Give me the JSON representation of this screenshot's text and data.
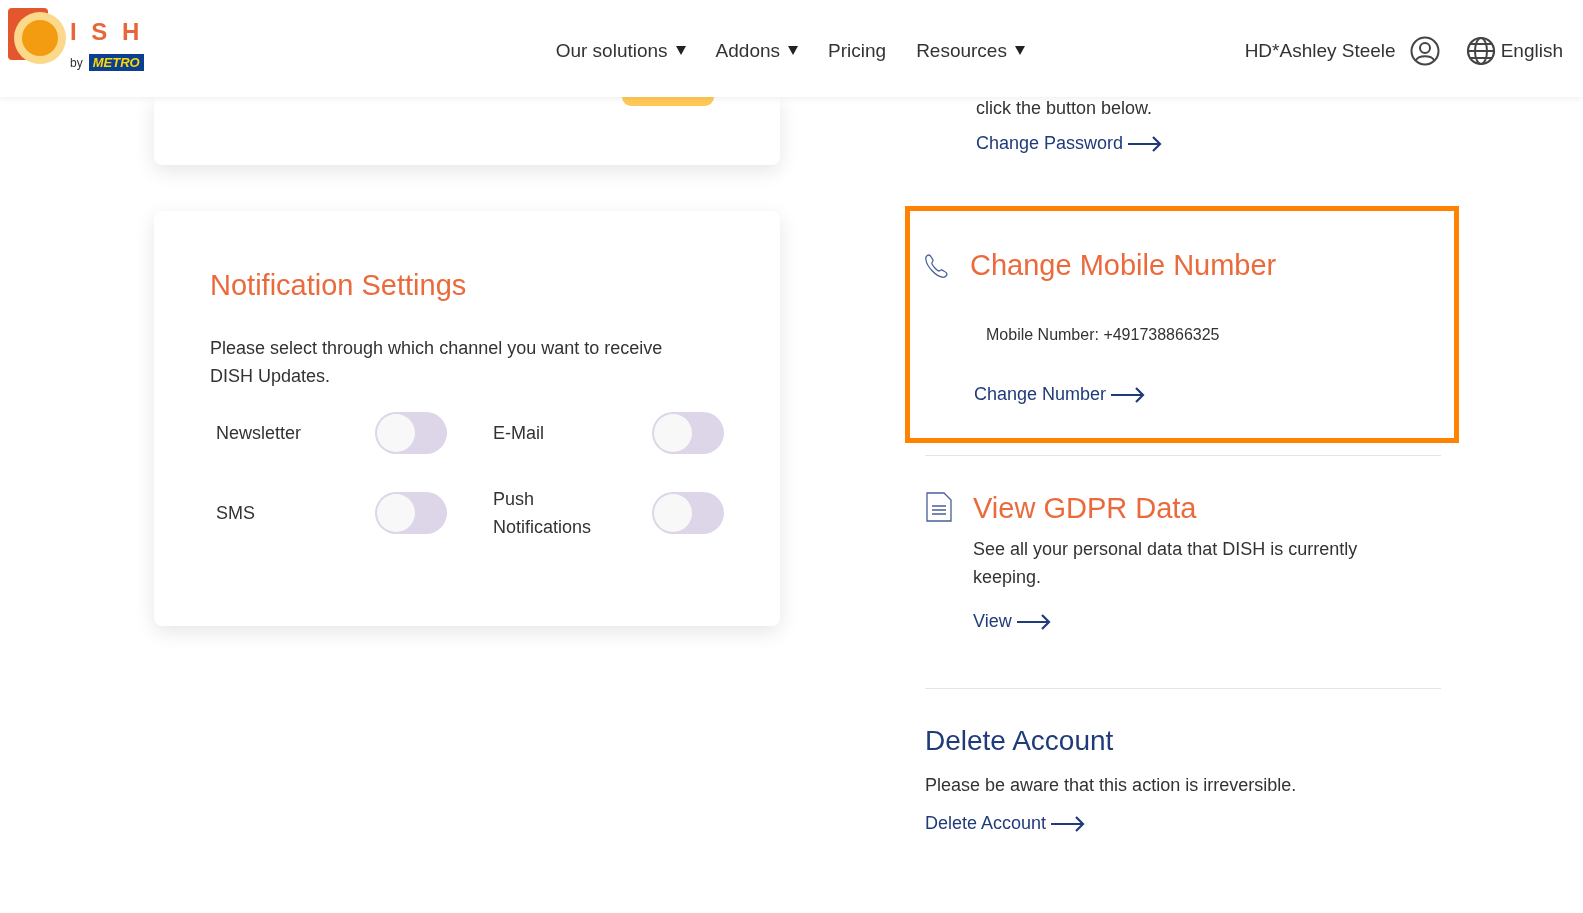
{
  "header": {
    "logo": {
      "letters": "I S H",
      "by": "by",
      "brand": "METRO"
    },
    "nav": [
      {
        "label": "Our solutions",
        "dropdown": true
      },
      {
        "label": "Addons",
        "dropdown": true
      },
      {
        "label": "Pricing",
        "dropdown": false
      },
      {
        "label": "Resources",
        "dropdown": true
      }
    ],
    "user": "HD*Ashley Steele",
    "language": "English"
  },
  "notifications": {
    "title": "Notification Settings",
    "description": "Please select through which channel you want to receive DISH Updates.",
    "channels": [
      {
        "label": "Newsletter",
        "checked": false
      },
      {
        "label": "SMS",
        "checked": false
      },
      {
        "label": "E-Mail",
        "checked": false
      },
      {
        "label": "Push Notifications",
        "checked": false
      }
    ]
  },
  "password": {
    "text": "click the button below.",
    "link": "Change Password"
  },
  "mobile": {
    "title": "Change Mobile Number",
    "number": "Mobile Number: +491738866325",
    "link": "Change Number",
    "highlighted": true
  },
  "gdpr": {
    "title": "View GDPR Data",
    "description": "See all your personal data that DISH is currently keeping.",
    "link": "View"
  },
  "delete": {
    "title": "Delete Account",
    "description": "Please be aware that this action is irreversible.",
    "link": "Delete Account"
  }
}
